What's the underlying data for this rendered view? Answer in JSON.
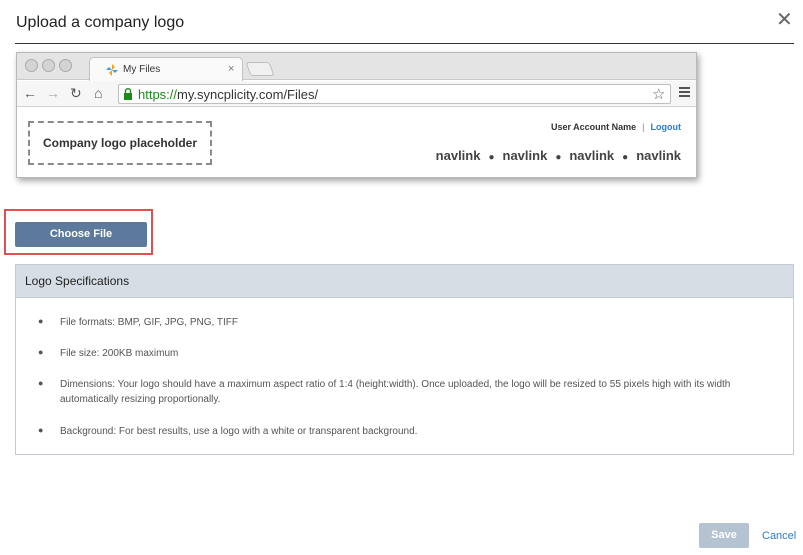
{
  "dialog": {
    "title": "Upload a company logo",
    "close_icon": "close-icon"
  },
  "browser_preview": {
    "tab_label": "My Files",
    "tab_close": "×",
    "url_scheme": "https://",
    "url_rest": "my.syncplicity.com/Files/",
    "logo_placeholder": "Company logo placeholder",
    "account_name": "User Account Name",
    "separator": "|",
    "logout": "Logout",
    "navlinks": [
      "navlink",
      "navlink",
      "navlink",
      "navlink"
    ]
  },
  "upload": {
    "choose_label": "Choose File"
  },
  "specs": {
    "title": "Logo Specifications",
    "items": [
      "File formats: BMP, GIF, JPG, PNG, TIFF",
      "File size: 200KB maximum",
      "Dimensions: Your logo should have a maximum aspect ratio of 1:4 (height:width). Once uploaded, the logo will be resized to 55 pixels high with its width automatically resizing proportionally.",
      "Background: For best results, use a logo with a white or transparent background."
    ]
  },
  "footer": {
    "save_label": "Save",
    "cancel_label": "Cancel"
  },
  "colors": {
    "primary_button": "#5d7a9c",
    "disabled_button": "#b4c2d1",
    "highlight": "#e05050",
    "link": "#2d7cc8",
    "url_green": "#1a8b1a"
  }
}
